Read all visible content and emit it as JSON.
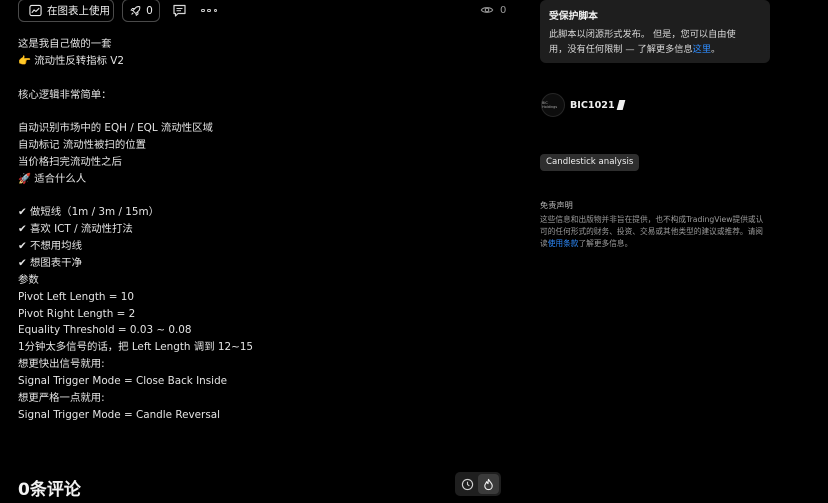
{
  "toolbar": {
    "use_on_chart_label": "在图表上使用",
    "boost_count": "0",
    "views_count": "0"
  },
  "description": {
    "lines": [
      "这是我自己做的一套",
      "👉 流动性反转指标 V2",
      "",
      "核心逻辑非常简单：",
      "",
      "自动识别市场中的 EQH / EQL 流动性区域",
      "自动标记 流动性被扫的位置",
      "当价格扫完流动性之后",
      "🚀 适合什么人",
      "",
      "✔ 做短线（1m / 3m / 15m）",
      "✔ 喜欢 ICT / 流动性打法",
      "✔ 不想用均线",
      "✔ 想图表干净",
      "参数",
      "Pivot Left Length = 10",
      "Pivot Right Length = 2",
      "Equality Threshold = 0.03 ~ 0.08",
      "1分钟太多信号的话，把 Left Length 调到 12~15",
      "想更快出信号就用:",
      "Signal Trigger Mode = Close Back Inside",
      "想更严格一点就用:",
      "Signal Trigger Mode = Candle Reversal"
    ]
  },
  "comments": {
    "title": "0条评论"
  },
  "protected": {
    "title": "受保护脚本",
    "text_line1": "此脚本以闭源形式发布。 但是，您可以自由使",
    "text_line2_a": "用，没有任何限制 — 了解更多信息",
    "text_line2_link": "这里",
    "text_line2_b": "。"
  },
  "author": {
    "avatar_text": "BIC Holdings",
    "name": "BIC1021"
  },
  "tag": {
    "label": "Candlestick analysis"
  },
  "disclaimer": {
    "title": "免责声明",
    "line1": "这些信息和出版物并非旨在提供，也不构成TradingView提供或认",
    "line2": "可的任何形式的财务、投资、交易或其他类型的建议或推荐。请阅",
    "line3_a": "读",
    "line3_link": "使用条款",
    "line3_b": "了解更多信息。"
  }
}
